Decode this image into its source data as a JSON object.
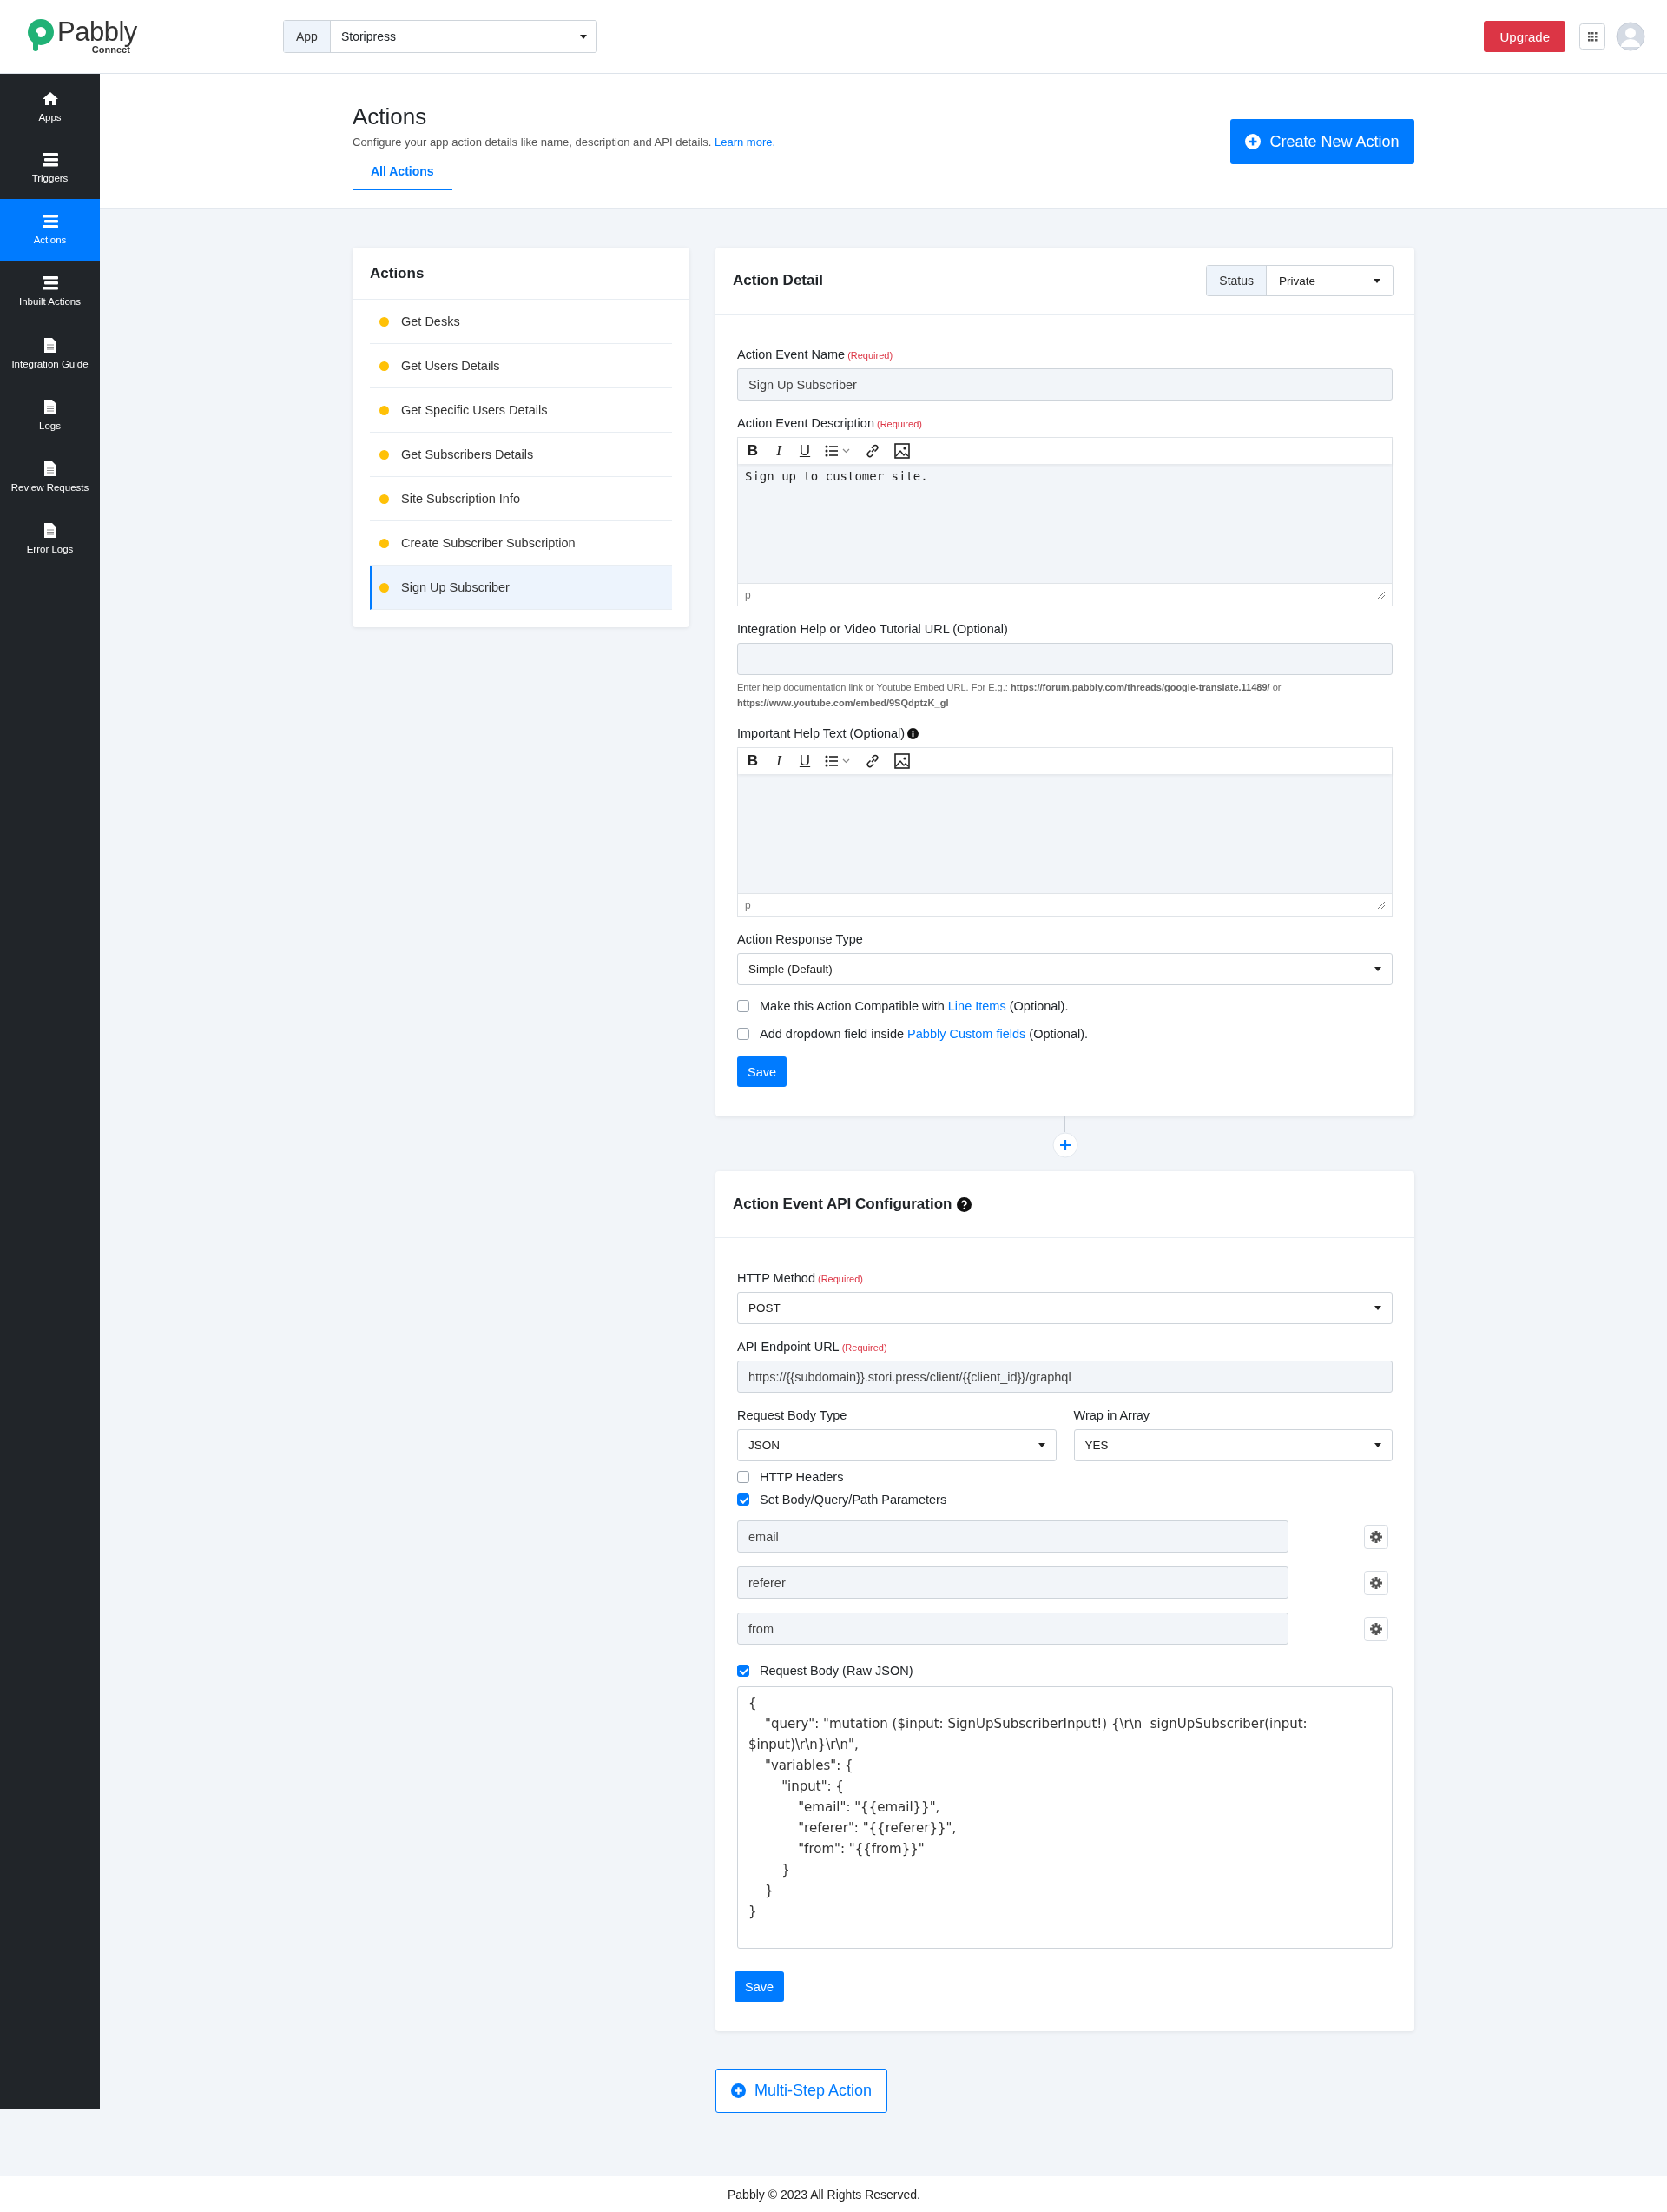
{
  "header": {
    "logo": "Pabbly",
    "logo_sub": "Connect",
    "app_label": "App",
    "app_value": "Storipress",
    "upgrade": "Upgrade"
  },
  "sidebar": [
    {
      "label": "Apps",
      "kind": "home",
      "selected": false
    },
    {
      "label": "Triggers",
      "kind": "list",
      "selected": false
    },
    {
      "label": "Actions",
      "kind": "list",
      "selected": true
    },
    {
      "label": "Inbuilt Actions",
      "kind": "list",
      "selected": false
    },
    {
      "label": "Integration Guide",
      "kind": "page",
      "selected": false
    },
    {
      "label": "Logs",
      "kind": "page",
      "selected": false
    },
    {
      "label": "Review Requests",
      "kind": "page",
      "selected": false
    },
    {
      "label": "Error Logs",
      "kind": "page",
      "selected": false
    }
  ],
  "page": {
    "title": "Actions",
    "description": "Configure your app action details like name, description and API details.",
    "learn_more": "Learn more.",
    "create_button": "Create New Action",
    "tabs": [
      {
        "label": "All Actions",
        "selected": true
      }
    ]
  },
  "actions_list": {
    "title": "Actions",
    "items": [
      {
        "name": "Get Desks",
        "color": "#ffc107",
        "selected": false
      },
      {
        "name": "Get Users Details",
        "color": "#ffc107",
        "selected": false
      },
      {
        "name": "Get Specific Users Details",
        "color": "#ffc107",
        "selected": false
      },
      {
        "name": "Get Subscribers Details",
        "color": "#ffc107",
        "selected": false
      },
      {
        "name": "Site Subscription Info",
        "color": "#ffc107",
        "selected": false
      },
      {
        "name": "Create Subscriber Subscription",
        "color": "#ffc107",
        "selected": false
      },
      {
        "name": "Sign Up Subscriber",
        "color": "#ffc107",
        "selected": true
      }
    ]
  },
  "action_detail": {
    "title": "Action Detail",
    "status_label": "Status",
    "status_value": "Private",
    "event_name": {
      "label": "Action Event Name",
      "required": "(Required)",
      "value": "Sign Up Subscriber"
    },
    "description": {
      "label": "Action Event Description",
      "required": "(Required)",
      "toolbar_marks": [
        "B",
        "I",
        "U"
      ],
      "text": "Sign up to customer site.",
      "footer": "p"
    },
    "help_url": {
      "label": "Integration Help or Video Tutorial URL (Optional)",
      "hint": "Enter help documentation link or Youtube Embed URL. For E.g.: **https://forum.pabbly.com/threads/google-translate.11489/** or **https://www.youtube.com/embed/9SQdptzK_gl**"
    },
    "help_text": {
      "label": "Important Help Text (Optional)",
      "toolbar_marks": [
        "B",
        "I",
        "U"
      ],
      "footer": "p"
    },
    "response_type": {
      "label": "Action Response Type",
      "value": "Simple (Default)"
    },
    "options": [
      {
        "before": "Make this Action Compatible with ",
        "link": "Line Items",
        "after": " (Optional).",
        "checked": false
      },
      {
        "before": "Add dropdown field inside ",
        "link": "Pabbly Custom fields",
        "after": " (Optional).",
        "checked": false
      }
    ],
    "save": "Save"
  },
  "api_config": {
    "title": "Action Event API Configuration",
    "http_method": {
      "label": "HTTP Method",
      "required": "(Required)",
      "value": "POST"
    },
    "endpoint": {
      "label": "API Endpoint URL",
      "required": "(Required)",
      "value": "https://{{subdomain}}.stori.press/client/{{client_id}}/graphql"
    },
    "body_type": {
      "label": "Request Body Type",
      "value": "JSON"
    },
    "wrap": {
      "label": "Wrap in Array",
      "value": "YES"
    },
    "headers": {
      "label": "HTTP Headers",
      "checked": false
    },
    "params": {
      "label": "Set Body/Query/Path Parameters",
      "checked": true,
      "items": [
        "email",
        "referer",
        "from"
      ]
    },
    "request_body": {
      "label": "Request Body (Raw JSON)",
      "checked": true,
      "text": "{\n\t\"query\": \"mutation ($input: SignUpSubscriberInput!) {\\r\\n  signUpSubscriber(input: $input)\\r\\n}\\r\\n\",\n\t\"variables\": {\n\t\t\"input\": {\n\t\t\t\"email\": \"{{email}}\",\n\t\t\t\"referer\": \"{{referer}}\",\n\t\t\t\"from\": \"{{from}}\"\n\t\t}\n\t}\n}"
    },
    "save": "Save"
  },
  "multi_step": "Multi-Step Action",
  "footer": "Pabbly © 2023 All Rights Reserved."
}
